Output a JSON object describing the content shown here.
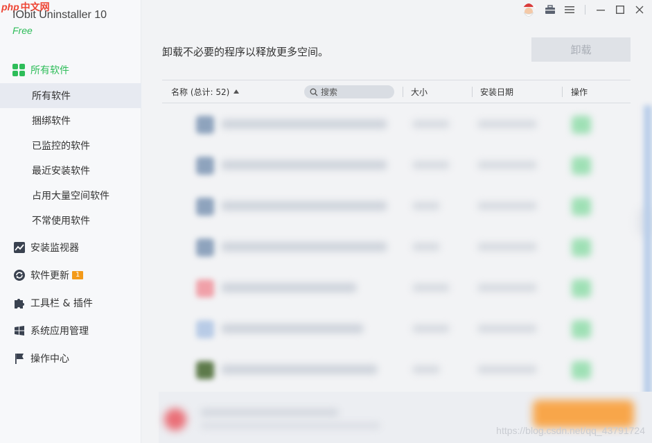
{
  "brand": {
    "site_logo": "php中文网",
    "site_logo_php": "php",
    "site_logo_cn": "中文网"
  },
  "app": {
    "title": "IObit Uninstaller 10",
    "edition": "Free"
  },
  "colors": {
    "accent": "#2ebd59",
    "badge": "#f39a1a"
  },
  "titlebar": {
    "icons": [
      "santa-avatar-icon",
      "toolbox-icon",
      "menu-icon",
      "minimize-icon",
      "maximize-icon",
      "close-icon"
    ]
  },
  "sidebar": {
    "main": {
      "label": "所有软件",
      "icon": "grid-icon"
    },
    "sub_items": [
      {
        "label": "所有软件",
        "active": true
      },
      {
        "label": "捆绑软件"
      },
      {
        "label": "已监控的软件"
      },
      {
        "label": "最近安装软件"
      },
      {
        "label": "占用大量空间软件"
      },
      {
        "label": "不常使用软件"
      }
    ],
    "sections": [
      {
        "label": "安装监视器",
        "icon": "monitor-chart-icon"
      },
      {
        "label": "软件更新",
        "icon": "refresh-icon",
        "badge": "1"
      },
      {
        "label": "工具栏 & 插件",
        "icon": "puzzle-icon"
      },
      {
        "label": "系统应用管理",
        "icon": "windows-logo-icon"
      },
      {
        "label": "操作中心",
        "icon": "flag-icon"
      }
    ]
  },
  "main": {
    "headline": "卸载不必要的程序以释放更多空间。",
    "uninstall_button": "卸载",
    "table": {
      "col_name": "名称 (总计: 52)",
      "search_placeholder": "搜索",
      "col_size": "大小",
      "col_date": "安装日期",
      "col_action": "操作"
    }
  },
  "watermark": "https://blog.csdn.net/qq_43791724"
}
